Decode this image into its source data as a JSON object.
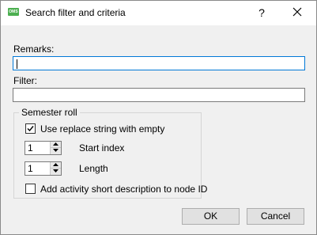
{
  "window": {
    "title": "Search filter and criteria",
    "icon": "app-icon",
    "icon_text": "OMS",
    "help_label": "?",
    "close_icon": "close-icon"
  },
  "form": {
    "remarks_label": "Remarks:",
    "remarks_value": "",
    "filter_label": "Filter:",
    "filter_value": ""
  },
  "semester_roll": {
    "title": "Semester roll",
    "replace_label": "Use replace string with empty",
    "replace_checked": true,
    "start_index_label": "Start index",
    "start_index_value": "1",
    "length_label": "Length",
    "length_value": "1",
    "add_activity_label": "Add activity short description to node ID",
    "add_activity_checked": false
  },
  "buttons": {
    "ok": "OK",
    "cancel": "Cancel"
  },
  "colors": {
    "focus_border": "#0078d7",
    "window_bg": "#f0f0f0",
    "icon_green": "#4caf50"
  }
}
